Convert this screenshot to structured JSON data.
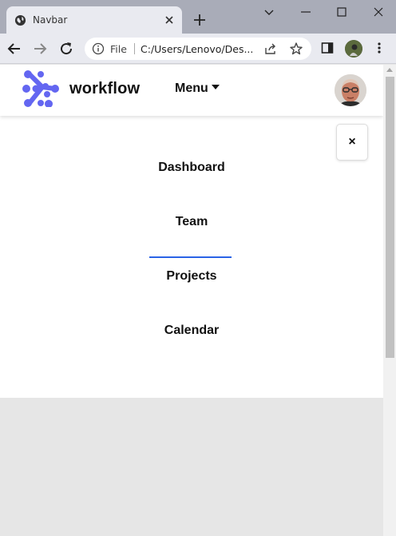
{
  "browser": {
    "tab_title": "Navbar",
    "omnibox_scheme": "File",
    "omnibox_url": "C:/Users/Lenovo/Des..."
  },
  "navbar": {
    "brand": "workflow",
    "menu_label": "Menu"
  },
  "menu": {
    "close_label": "×",
    "items": [
      {
        "label": "Dashboard",
        "active": true
      },
      {
        "label": "Team",
        "active": false
      },
      {
        "label": "Projects",
        "active": false
      },
      {
        "label": "Calendar",
        "active": false
      }
    ]
  },
  "colors": {
    "accent": "#2a63e6",
    "logo": "#6366f1"
  }
}
